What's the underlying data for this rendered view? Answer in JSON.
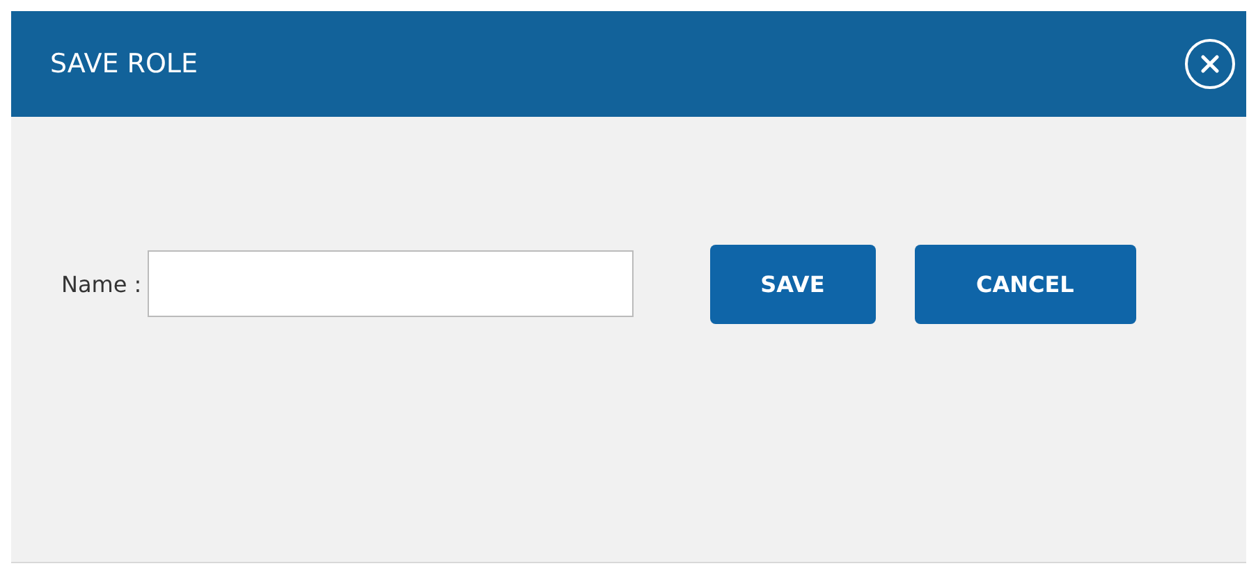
{
  "dialog": {
    "title": "SAVE ROLE"
  },
  "form": {
    "label": "Name :"
  },
  "buttons": [
    {
      "label": "SAVE"
    },
    {
      "label": "CANCEL"
    }
  ]
}
